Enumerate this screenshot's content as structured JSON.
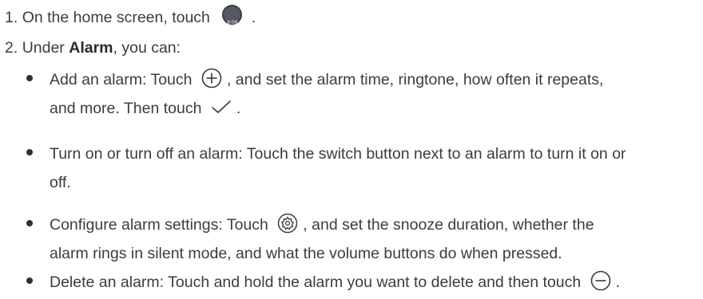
{
  "steps": [
    {
      "number": "1.",
      "before": "On the home screen, touch",
      "icon": "clock-app-icon",
      "icon_text": "8:08",
      "after": "."
    },
    {
      "number": "2.",
      "before": "Under",
      "bold": "Alarm",
      "after": ", you can:"
    }
  ],
  "bullets": [
    {
      "line1_before": "Add an alarm: Touch",
      "icon": "add-circle-icon",
      "line1_after": ", and set the alarm time, ringtone, how often it repeats,",
      "line2_before": "and more. Then touch",
      "icon2": "checkmark-icon",
      "line2_after": "."
    },
    {
      "line1": "Turn on or turn off an alarm: Touch the switch button next to an alarm to turn it on or",
      "line2": "off."
    },
    {
      "line1_before": "Configure alarm settings: Touch",
      "icon": "settings-gear-icon",
      "line1_after": ", and set the snooze duration, whether the",
      "line2": "alarm rings in silent mode, and what the volume buttons do when pressed."
    },
    {
      "line1_before": "Delete an alarm: Touch and hold the alarm you want to delete and then touch",
      "icon": "remove-circle-icon",
      "line1_after": "."
    }
  ]
}
